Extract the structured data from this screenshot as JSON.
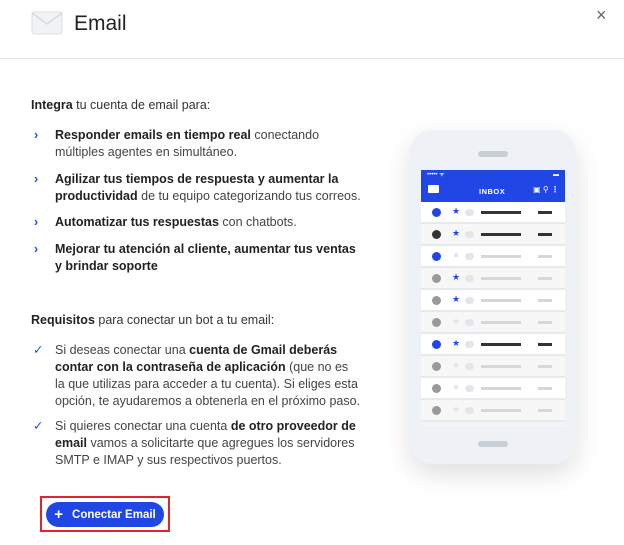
{
  "header": {
    "title": "Email",
    "close_symbol": "×"
  },
  "intro": {
    "bold": "Integra",
    "text": " tu cuenta de email para:"
  },
  "features": [
    {
      "bold": "Responder emails en tiempo real",
      "text": " conectando múltiples agentes en simultáneo."
    },
    {
      "bold": "Agilizar tus tiempos de respuesta y aumentar la productividad",
      "text": " de tu equipo categorizando tus correos."
    },
    {
      "bold": "Automatizar tus respuestas",
      "text": " con chatbots."
    },
    {
      "bold": "Mejorar tu atención al cliente, aumentar tus ventas y brindar soporte",
      "text": ""
    }
  ],
  "requirements": {
    "bold": "Requisitos",
    "text": " para conectar un bot a tu email:"
  },
  "req_items": [
    {
      "p1": "Si deseas conectar una ",
      "b1": "cuenta de Gmail deberás contar con la contraseña de aplicación",
      "p2": " (que no es la que utilizas para acceder a tu cuenta). Si eliges esta opción, te ayudaremos a obtenerla en el próximo paso."
    },
    {
      "p1": "Si quieres conectar una cuenta ",
      "b1": "de otro proveedor de email",
      "p2": " vamos a solicitarte que agregues los servidores SMTP e IMAP y sus respectivos puertos."
    }
  ],
  "button": {
    "label": "Conectar Email",
    "icon": "plus-icon"
  },
  "phone": {
    "inbox_label": "INBOX",
    "accent_color": "#2146e6",
    "rows": [
      {
        "star": true,
        "dark": true
      },
      {
        "star": true,
        "dark": true
      },
      {
        "star": false,
        "dark": false
      },
      {
        "star": true,
        "dark": false
      },
      {
        "star": true,
        "dark": false
      },
      {
        "star": false,
        "dark": false
      },
      {
        "star": true,
        "dark": true
      },
      {
        "star": false,
        "dark": false
      },
      {
        "star": false,
        "dark": false
      },
      {
        "star": false,
        "dark": false
      }
    ]
  }
}
